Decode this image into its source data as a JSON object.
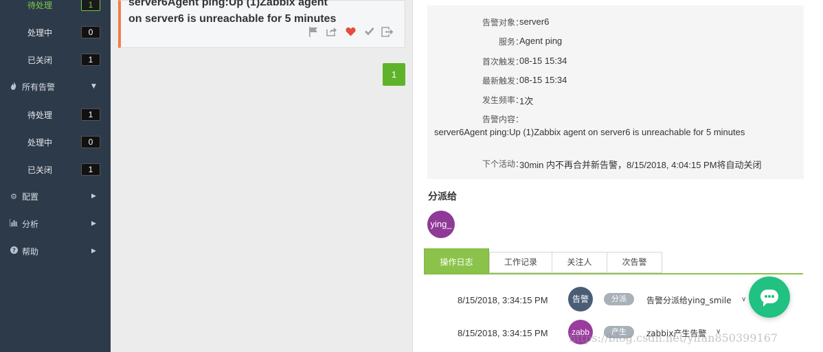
{
  "sidebar": {
    "rows": [
      {
        "label": "待处理",
        "count": "1",
        "active": true
      },
      {
        "label": "处理中",
        "count": "0"
      },
      {
        "label": "已关闭",
        "count": "1"
      }
    ],
    "all_alarms_label": "所有告警",
    "rows2": [
      {
        "label": "待处理",
        "count": "1"
      },
      {
        "label": "处理中",
        "count": "0"
      },
      {
        "label": "已关闭",
        "count": "1"
      }
    ],
    "config_label": "配置",
    "analysis_label": "分析",
    "help_label": "帮助",
    "icons": {
      "all_alarms": "flame-icon",
      "config": "gear-icon",
      "analysis": "bar-chart-icon",
      "help": "question-icon"
    }
  },
  "alarm": {
    "title_line1": "server6Agent ping:Up (1)Zabbix agent",
    "title_line2": "on server6 is unreachable for 5 minutes",
    "accent_color": "#ee7d4a",
    "action_icons": [
      "flag-icon",
      "share-icon",
      "heart-icon",
      "check-icon",
      "exit-icon"
    ]
  },
  "pagination": {
    "current": "1"
  },
  "detail": {
    "target_key": "告警对象：",
    "target_val": "server6",
    "service_key": "服务：",
    "service_val": "Agent ping",
    "first_key": "首次触发：",
    "first_val": "08-15 15:34",
    "last_key": "最新触发：",
    "last_val": "08-15 15:34",
    "freq_key": "发生频率：",
    "freq_val": "1次",
    "content_key": "告警内容：",
    "content_val": "server6Agent ping:Up (1)Zabbix agent on server6 is unreachable for 5 minutes",
    "next_key": "下个活动：",
    "next_val": "30min 内不再合并新告警，8/15/2018, 4:04:15 PM将自动关闭"
  },
  "assign": {
    "title": "分派给",
    "avatar": "ying_"
  },
  "tabs": [
    {
      "label": "操作日志",
      "active": true
    },
    {
      "label": "工作记录"
    },
    {
      "label": "关注人"
    },
    {
      "label": "次告警"
    }
  ],
  "logs": [
    {
      "time": "8/15/2018, 3:34:15 PM",
      "avatar": "告警",
      "tag": "分派",
      "text": "告警分派给ying_smile"
    },
    {
      "time": "8/15/2018, 3:34:15 PM",
      "avatar": "zabb",
      "tag": "产生",
      "text": "zabbix产生告警"
    }
  ],
  "watermark": "https://blog.csdn.net/yifan850399167",
  "colors": {
    "sidebar_bg": "#2d3a4a",
    "active_green": "#7cc94a",
    "tab_green": "#8bc34a",
    "chat_green": "#21c181"
  }
}
